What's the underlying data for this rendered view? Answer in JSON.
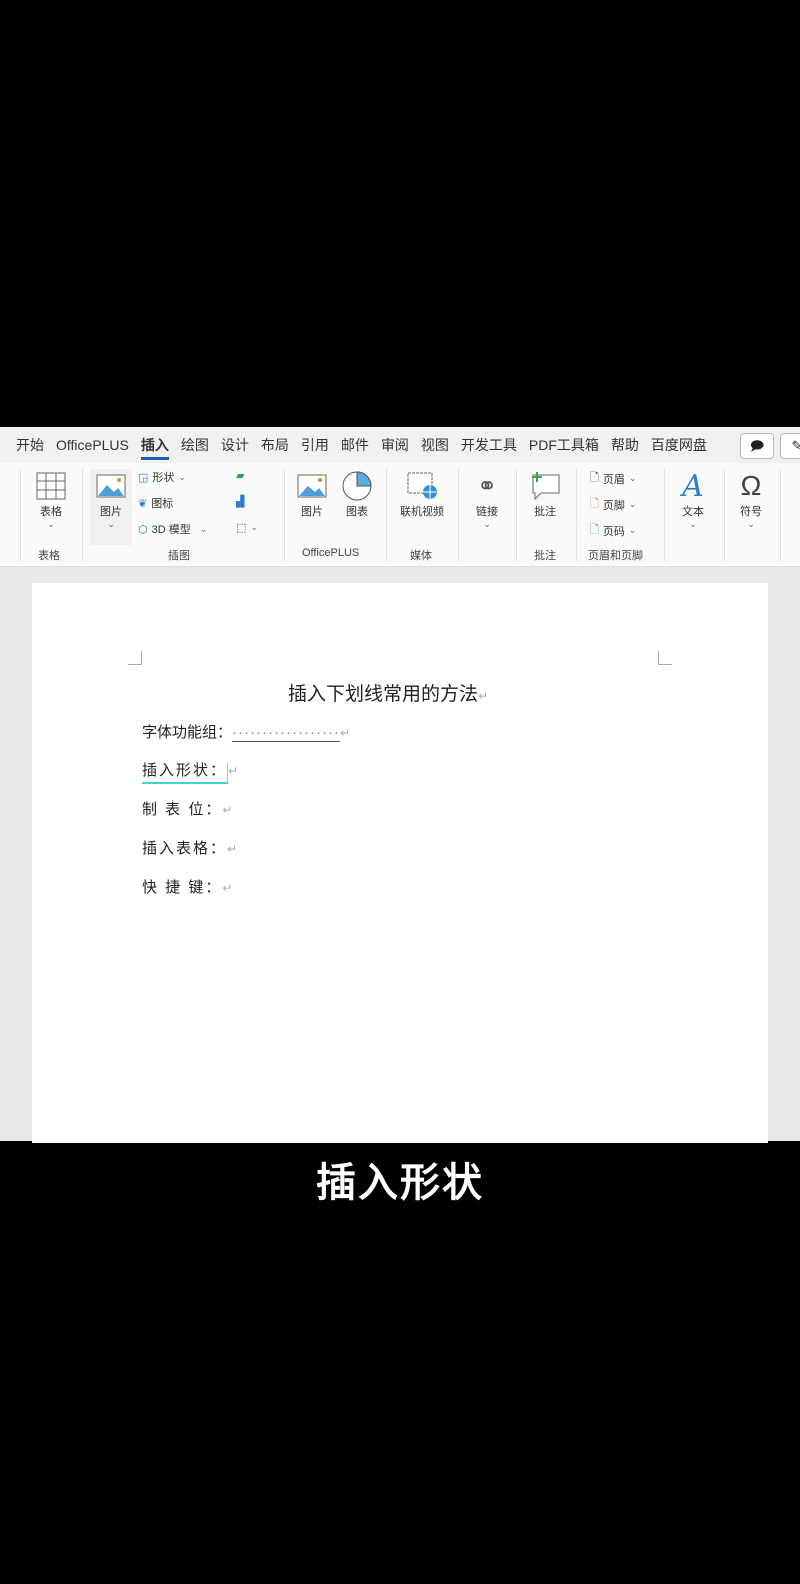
{
  "tabs": [
    "开始",
    "OfficePLUS",
    "插入",
    "绘图",
    "设计",
    "布局",
    "引用",
    "邮件",
    "审阅",
    "视图",
    "开发工具",
    "PDF工具箱",
    "帮助",
    "百度网盘"
  ],
  "active_tab": "插入",
  "ribbon": {
    "table": {
      "label": "表格",
      "group": "表格"
    },
    "illustrations": {
      "picture": "图片",
      "shapes": "形状",
      "icons": "图标",
      "model3d": "3D 模型",
      "group": "插图"
    },
    "officeplus": {
      "picture": "图片",
      "chart": "图表",
      "group": "OfficePLUS"
    },
    "media": {
      "online_video": "联机视频",
      "group": "媒体"
    },
    "link": {
      "label": "链接"
    },
    "comment": {
      "label": "批注",
      "group": "批注"
    },
    "header_footer": {
      "header": "页眉",
      "footer": "页脚",
      "page_number": "页码",
      "group": "页眉和页脚"
    },
    "text": {
      "label": "文本"
    },
    "symbol": {
      "label": "符号"
    }
  },
  "document": {
    "title": "插入下划线常用的方法",
    "lines": [
      "字体功能组：",
      "插入形状：",
      "制 表 位：",
      "插入表格：",
      "快 捷 键："
    ],
    "dots": "··················"
  },
  "caption": "插入形状",
  "colors": {
    "accent": "#1a5fb4",
    "shape_underline": "#3dd6d0"
  }
}
